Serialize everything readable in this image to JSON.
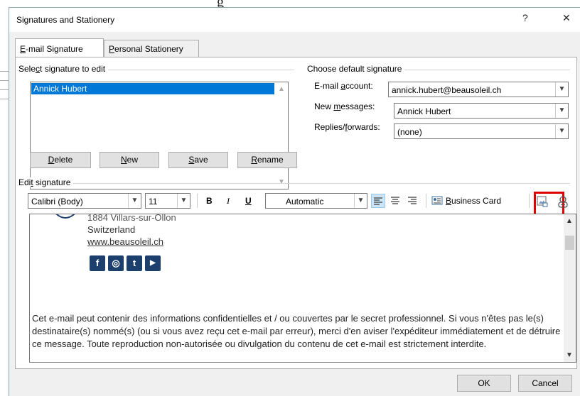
{
  "dialog": {
    "title": "Signatures and Stationery",
    "help_glyph": "?",
    "close_glyph": "✕"
  },
  "tabs": [
    {
      "label": "E-mail Signature",
      "underline": "E",
      "rest": "-mail Signature"
    },
    {
      "label": "Personal Stationery",
      "underline": "P",
      "rest": "ersonal Stationery"
    }
  ],
  "select_section": {
    "label_pre": "Sele",
    "label_u": "c",
    "label_post": "t signature to edit",
    "signatures": [
      "Annick Hubert"
    ],
    "buttons": {
      "delete": {
        "u": "D",
        "rest": "elete"
      },
      "new": {
        "u": "N",
        "rest": "ew"
      },
      "save": {
        "u": "S",
        "rest": "ave"
      },
      "rename": {
        "u": "R",
        "rest": "ename"
      }
    }
  },
  "default_section": {
    "label": "Choose default signature",
    "email_account_label_pre": "E-mail ",
    "email_account_label_u": "a",
    "email_account_label_post": "ccount:",
    "email_account_value": "annick.hubert@beausoleil.ch",
    "new_messages_label_pre": "New ",
    "new_messages_label_u": "m",
    "new_messages_label_post": "essages:",
    "new_messages_value": "Annick Hubert",
    "replies_label_pre": "Replies/",
    "replies_label_u": "f",
    "replies_label_post": "orwards:",
    "replies_value": "(none)"
  },
  "edit_section": {
    "label_pre": "Edi",
    "label_u": "t",
    "label_post": " signature",
    "font_value": "Calibri (Body)",
    "size_value": "11",
    "bold": "B",
    "italic": "I",
    "underline": "U",
    "color_value": "Automatic",
    "business_card_pre": "",
    "business_card_u": "B",
    "business_card_post": "usiness Card"
  },
  "signature_body": {
    "address_line": "1884 Villars-sur-Ollon",
    "country": "Switzerland",
    "website": "www.beausoleil.ch",
    "social_icons": [
      "facebook-icon",
      "instagram-icon",
      "twitter-icon",
      "youtube-icon"
    ],
    "social_glyphs": [
      "f",
      "◎",
      "t",
      "▶"
    ],
    "disclaimer": "Cet e-mail peut contenir des informations confidentielles et / ou couvertes par le secret professionnel. Si vous n'êtes pas le(s) destinataire(s) nommé(s) (ou si vous avez reçu cet e-mail par erreur), merci d'en aviser l'expéditeur immédiatement et de détruire ce message. Toute reproduction non-autorisée ou divulgation du contenu de cet e-mail est strictement interdite."
  },
  "footer": {
    "ok": "OK",
    "cancel": "Cancel"
  },
  "colors": {
    "selection": "#0078d7",
    "highlight_box": "#e00000",
    "social_icon_bg": "#1c3f6e"
  }
}
